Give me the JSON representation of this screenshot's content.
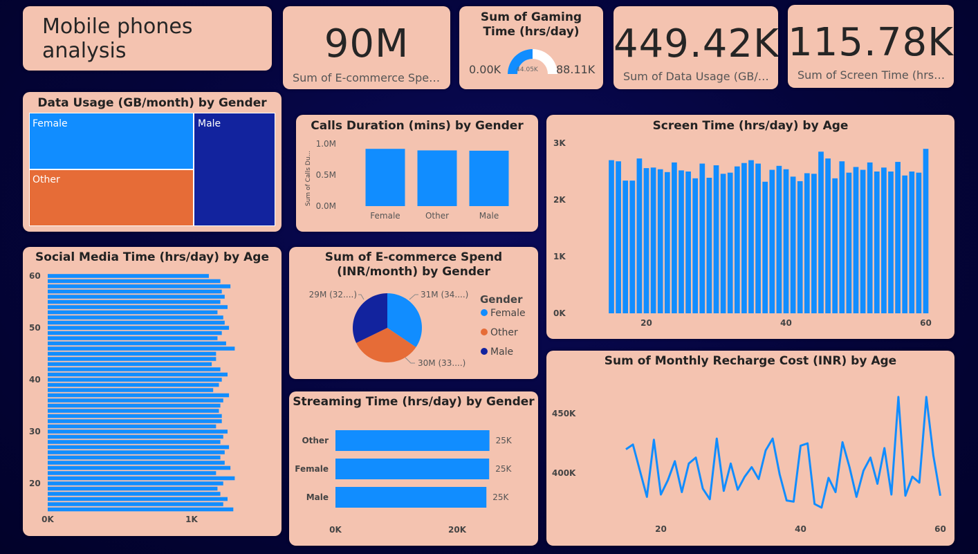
{
  "dashboard_title": "Mobile phones analysis",
  "colors": {
    "primary": "#118dff",
    "orange": "#e66c37",
    "navy": "#12239e",
    "card": "#f4c3b0"
  },
  "kpis": {
    "ecommerce": {
      "value": "90M",
      "label": "Sum of E-commerce Spen..."
    },
    "data_usage": {
      "value": "449.42K",
      "label": "Sum of Data Usage (GB/m..."
    },
    "screen_time": {
      "value": "115.78K",
      "label": "Sum of Screen Time (hrs/d..."
    }
  },
  "gauge": {
    "title": "Sum of Gaming Time (hrs/day)",
    "min_label": "0.00K",
    "max_label": "88.11K",
    "value_label": "44.05K",
    "fraction": 0.5
  },
  "treemap": {
    "title": "Data Usage (GB/month) by Gender",
    "labels": {
      "female": "Female",
      "male": "Male",
      "other": "Other"
    }
  },
  "chart_data": [
    {
      "id": "calls",
      "type": "bar",
      "title": "Calls Duration (mins) by Gender",
      "ylabel": "Sum of Calls Du...",
      "categories": [
        "Female",
        "Other",
        "Male"
      ],
      "values": [
        920000,
        895000,
        890000
      ],
      "ylim": [
        0,
        1000000
      ],
      "yticks": [
        "0.0M",
        "0.5M",
        "1.0M"
      ]
    },
    {
      "id": "screen",
      "type": "bar",
      "title": "Screen Time (hrs/day) by Age",
      "x": [
        15,
        16,
        17,
        18,
        19,
        20,
        21,
        22,
        23,
        24,
        25,
        26,
        27,
        28,
        29,
        30,
        31,
        32,
        33,
        34,
        35,
        36,
        37,
        38,
        39,
        40,
        41,
        42,
        43,
        44,
        45,
        46,
        47,
        48,
        49,
        50,
        51,
        52,
        53,
        54,
        55,
        56,
        57,
        58,
        59,
        60
      ],
      "values": [
        2700,
        2680,
        2340,
        2340,
        2730,
        2560,
        2570,
        2540,
        2490,
        2660,
        2520,
        2500,
        2380,
        2640,
        2390,
        2610,
        2460,
        2480,
        2590,
        2650,
        2700,
        2640,
        2320,
        2530,
        2600,
        2540,
        2410,
        2330,
        2470,
        2460,
        2850,
        2730,
        2380,
        2680,
        2480,
        2580,
        2530,
        2660,
        2500,
        2570,
        2500,
        2670,
        2430,
        2500,
        2480,
        2900,
        2570,
        2340
      ],
      "ylim": [
        0,
        3000
      ],
      "yticks": [
        "0K",
        "1K",
        "2K",
        "3K"
      ],
      "xticks": [
        "20",
        "40",
        "60"
      ]
    },
    {
      "id": "social",
      "type": "bar",
      "orientation": "horizontal",
      "title": "Social Media Time (hrs/day) by Age",
      "y": [
        60,
        59,
        58,
        57,
        56,
        55,
        54,
        53,
        52,
        51,
        50,
        49,
        48,
        47,
        46,
        45,
        44,
        43,
        42,
        41,
        40,
        39,
        38,
        37,
        36,
        35,
        34,
        33,
        32,
        31,
        30,
        29,
        28,
        27,
        26,
        25,
        24,
        23,
        22,
        21,
        20,
        19,
        18,
        17,
        16,
        15
      ],
      "values": [
        1120,
        1200,
        1270,
        1210,
        1230,
        1200,
        1250,
        1180,
        1220,
        1230,
        1260,
        1210,
        1180,
        1240,
        1300,
        1170,
        1170,
        1140,
        1200,
        1250,
        1210,
        1190,
        1150,
        1260,
        1220,
        1200,
        1190,
        1210,
        1210,
        1170,
        1250,
        1220,
        1200,
        1260,
        1230,
        1200,
        1230,
        1270,
        1170,
        1300,
        1220,
        1180,
        1200,
        1250,
        1220,
        1290,
        1220,
        1150,
        1230,
        1300
      ],
      "xlim": [
        0,
        1350
      ],
      "xticks": [
        "0K",
        "1K"
      ],
      "yticks": [
        "20",
        "30",
        "40",
        "50",
        "60"
      ]
    },
    {
      "id": "ecom_pie",
      "type": "pie",
      "title": "Sum of E-commerce Spend (INR/month) by Gender",
      "legend_title": "Gender",
      "categories": [
        "Female",
        "Other",
        "Male"
      ],
      "values": [
        31,
        30,
        29
      ],
      "labels": [
        "31M (34....)",
        "30M (33....)",
        "29M (32....)"
      ]
    },
    {
      "id": "streaming",
      "type": "bar",
      "orientation": "horizontal",
      "title": "Streaming Time (hrs/day) by Gender",
      "categories": [
        "Other",
        "Female",
        "Male"
      ],
      "values": [
        25300,
        25250,
        24800
      ],
      "data_labels": [
        "25K",
        "25K",
        "25K"
      ],
      "xlim": [
        0,
        27000
      ],
      "xticks": [
        "0K",
        "20K"
      ]
    },
    {
      "id": "recharge",
      "type": "line",
      "title": "Sum of Monthly Recharge Cost (INR) by Age",
      "x": [
        15,
        16,
        17,
        18,
        19,
        20,
        21,
        22,
        23,
        24,
        25,
        26,
        27,
        28,
        29,
        30,
        31,
        32,
        33,
        34,
        35,
        36,
        37,
        38,
        39,
        40,
        41,
        42,
        43,
        44,
        45,
        46,
        47,
        48,
        49,
        50,
        51,
        52,
        53,
        54,
        55,
        56,
        57,
        58,
        59,
        60
      ],
      "values": [
        420000,
        424000,
        402000,
        380000,
        428000,
        382000,
        394000,
        410000,
        384000,
        408000,
        413000,
        387000,
        378000,
        429000,
        385000,
        408000,
        386000,
        397000,
        405000,
        395000,
        419000,
        429000,
        399000,
        377000,
        376000,
        423000,
        425000,
        374000,
        371000,
        396000,
        384000,
        426000,
        405000,
        380000,
        402000,
        413000,
        391000,
        421000,
        382000,
        464000,
        381000,
        397000,
        392000,
        464000,
        415000,
        381000
      ],
      "ylim": [
        368000,
        470000
      ],
      "yticks": [
        "400K",
        "450K"
      ],
      "xticks": [
        "20",
        "40",
        "60"
      ]
    }
  ]
}
